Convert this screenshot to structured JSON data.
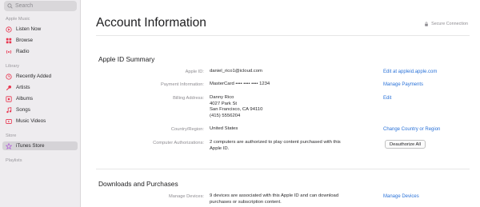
{
  "sidebar": {
    "search_placeholder": "Search",
    "sections": [
      {
        "header": "Apple Music",
        "items": [
          {
            "label": "Listen Now",
            "icon": "play-circle-icon"
          },
          {
            "label": "Browse",
            "icon": "grid-icon"
          },
          {
            "label": "Radio",
            "icon": "radio-waves-icon"
          }
        ]
      },
      {
        "header": "Library",
        "items": [
          {
            "label": "Recently Added",
            "icon": "clock-icon"
          },
          {
            "label": "Artists",
            "icon": "microphone-icon"
          },
          {
            "label": "Albums",
            "icon": "album-icon"
          },
          {
            "label": "Songs",
            "icon": "music-note-icon"
          },
          {
            "label": "Music Videos",
            "icon": "video-icon"
          }
        ]
      },
      {
        "header": "Store",
        "items": [
          {
            "label": "iTunes Store",
            "icon": "star-icon",
            "selected": true
          }
        ]
      },
      {
        "header": "Playlists",
        "items": []
      }
    ],
    "accent_color": "#e8344e",
    "store_accent_color": "#b05cd9"
  },
  "main": {
    "title": "Account Information",
    "secure_label": "Secure Connection",
    "summary": {
      "title": "Apple ID Summary",
      "rows": [
        {
          "label": "Apple ID:",
          "value": "daniel_rico1@icloud.com",
          "action": "Edit at appleid.apple.com"
        },
        {
          "label": "Payment Information:",
          "value": "MasterCard •••• •••• •••• 1234",
          "action": "Manage Payments"
        },
        {
          "label": "Billing Address:",
          "value_lines": [
            "Danny Rico",
            "4027 Park St",
            "San Francisco, CA 94110",
            "(415) 5556204"
          ],
          "action": "Edit"
        },
        {
          "label": "Country/Region:",
          "value": "United States",
          "action": "Change Country or Region"
        },
        {
          "label": "Computer Authorizations:",
          "value_lines": [
            "2 computers are authorized to play content purchased with this",
            "Apple ID."
          ],
          "action": "Deauthorize All"
        }
      ]
    },
    "downloads": {
      "title": "Downloads and Purchases",
      "rows": [
        {
          "label": "Manage Devices:",
          "value_lines": [
            "9 devices are associated with this Apple ID and can download",
            "purchases or subscription content."
          ],
          "action": "Manage Devices"
        }
      ]
    },
    "link_color": "#2a72d8"
  }
}
